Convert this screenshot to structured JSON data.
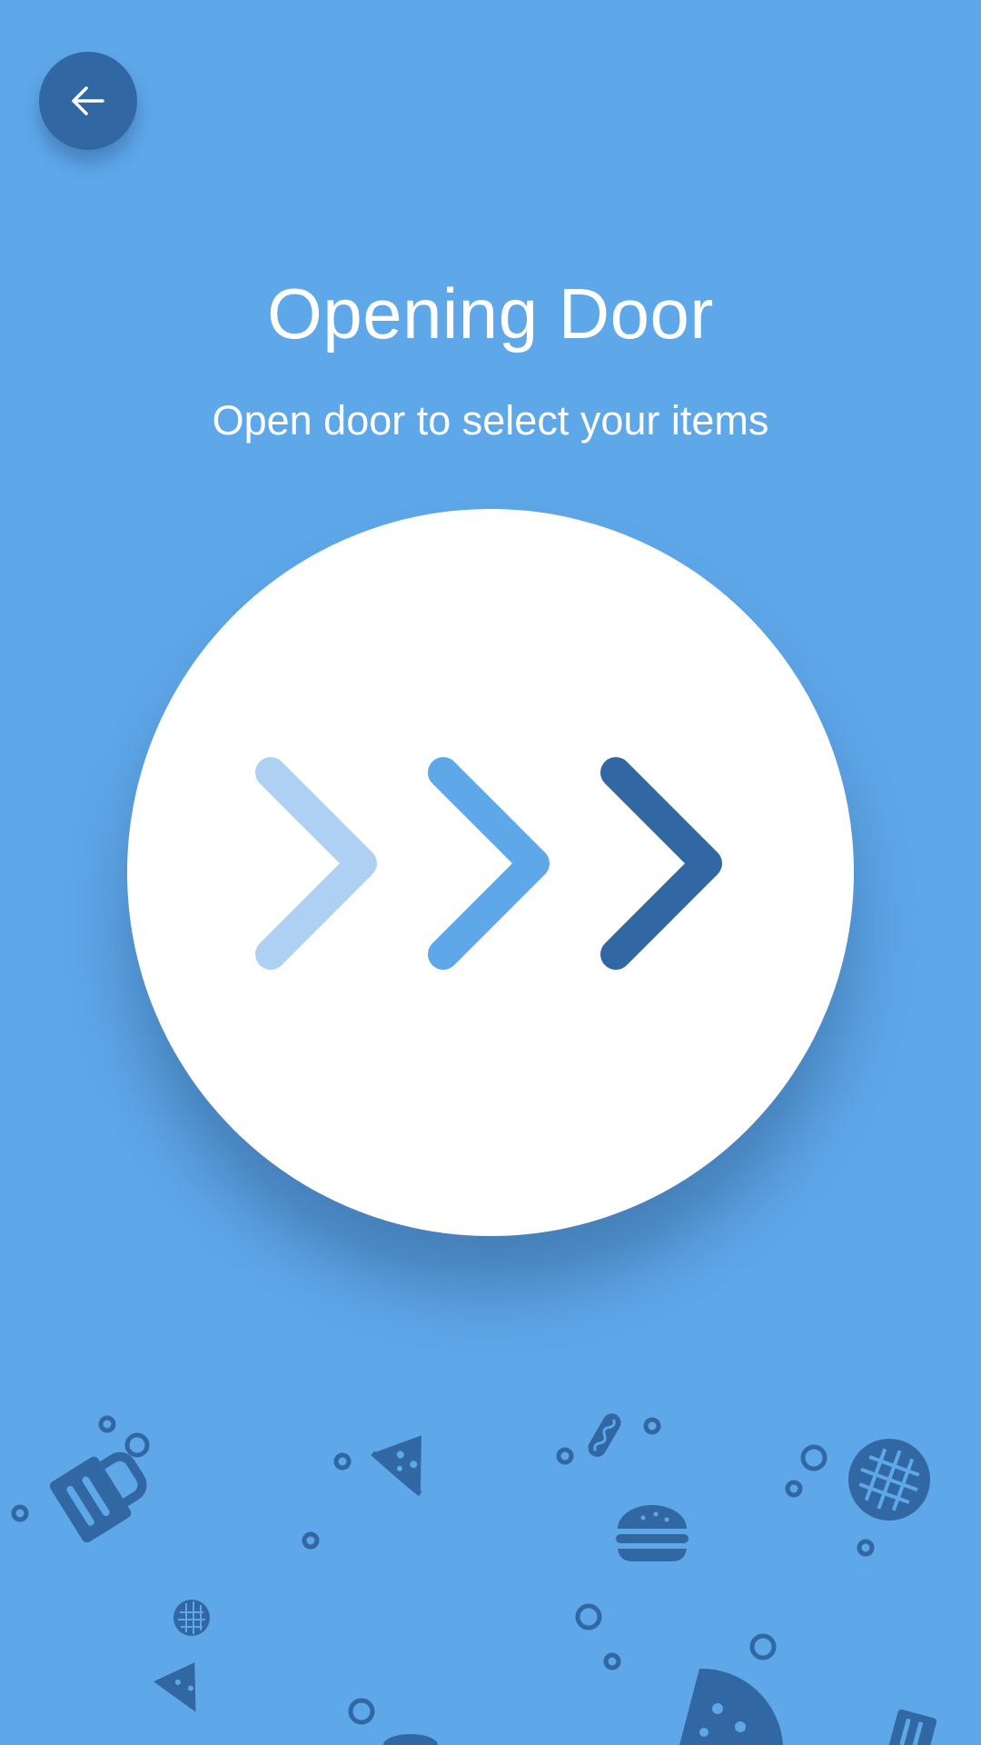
{
  "header": {
    "back_icon": "arrow-left-icon"
  },
  "main": {
    "title": "Opening Door",
    "subtitle": "Open door to select your items",
    "door_icon": "triple-chevron-right-icon"
  },
  "colors": {
    "background": "#5ea7e8",
    "accent_dark": "#3168a3",
    "chevron_light": "#aed0f3",
    "chevron_mid": "#5ea7e8",
    "chevron_dark": "#3168a3",
    "circle": "#ffffff"
  },
  "decorations": {
    "icons": [
      "beer-mug-icon",
      "pizza-slice-icon",
      "hotdog-icon",
      "burger-icon",
      "waffle-icon",
      "cookie-icon"
    ]
  }
}
